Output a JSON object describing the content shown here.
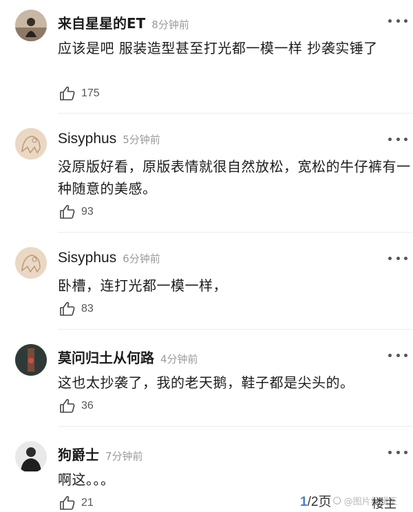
{
  "comments": [
    {
      "username": "来自星星的ET",
      "time": "8分钟前",
      "text": "应该是吧 服装造型甚至打光都一模一样 抄袭实锤了",
      "likes": "175"
    },
    {
      "username": "Sisyphus",
      "time": "5分钟前",
      "text": "没原版好看，原版表情就很自然放松，宽松的牛仔裤有一种随意的美感。",
      "likes": "93"
    },
    {
      "username": "Sisyphus",
      "time": "6分钟前",
      "text": "卧槽，连打光都一模一样，",
      "likes": "83"
    },
    {
      "username": "莫问归土从何路",
      "time": "4分钟前",
      "text": "这也太抄袭了，我的老天鹅，鞋子都是尖头的。",
      "likes": "36"
    },
    {
      "username": "狗爵士",
      "time": "7分钟前",
      "text": "啊这。。。",
      "likes": "21"
    }
  ],
  "pager": {
    "current": "1",
    "total": "/2",
    "unit": "页"
  },
  "watermark": {
    "text": "@图片编辑王",
    "louzhu": "楼主"
  },
  "icons": {
    "like": "thumbs-up-icon",
    "more": "more-dots-icon"
  },
  "colors": {
    "pager": "#4b7bd4",
    "time": "#9a9a9a"
  }
}
